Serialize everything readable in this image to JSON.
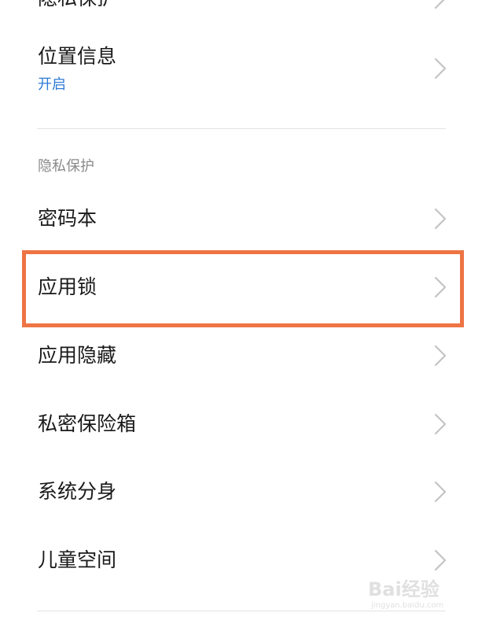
{
  "settings": {
    "top_partial_item": {
      "label": "隐私保护"
    },
    "location": {
      "label": "位置信息",
      "status": "开启"
    },
    "section_privacy": {
      "header": "隐私保护"
    },
    "items": [
      {
        "label": "密码本"
      },
      {
        "label": "应用锁"
      },
      {
        "label": "应用隐藏"
      },
      {
        "label": "私密保险箱"
      },
      {
        "label": "系统分身"
      },
      {
        "label": "儿童空间"
      }
    ]
  },
  "annotation": {
    "highlight_color": "#ee7445",
    "highlighted_item": "应用锁"
  },
  "watermark": {
    "logo": "Bai经验",
    "url": "jingyan.baidu.com"
  },
  "icons": {
    "chevron": "chevron-right-icon"
  }
}
